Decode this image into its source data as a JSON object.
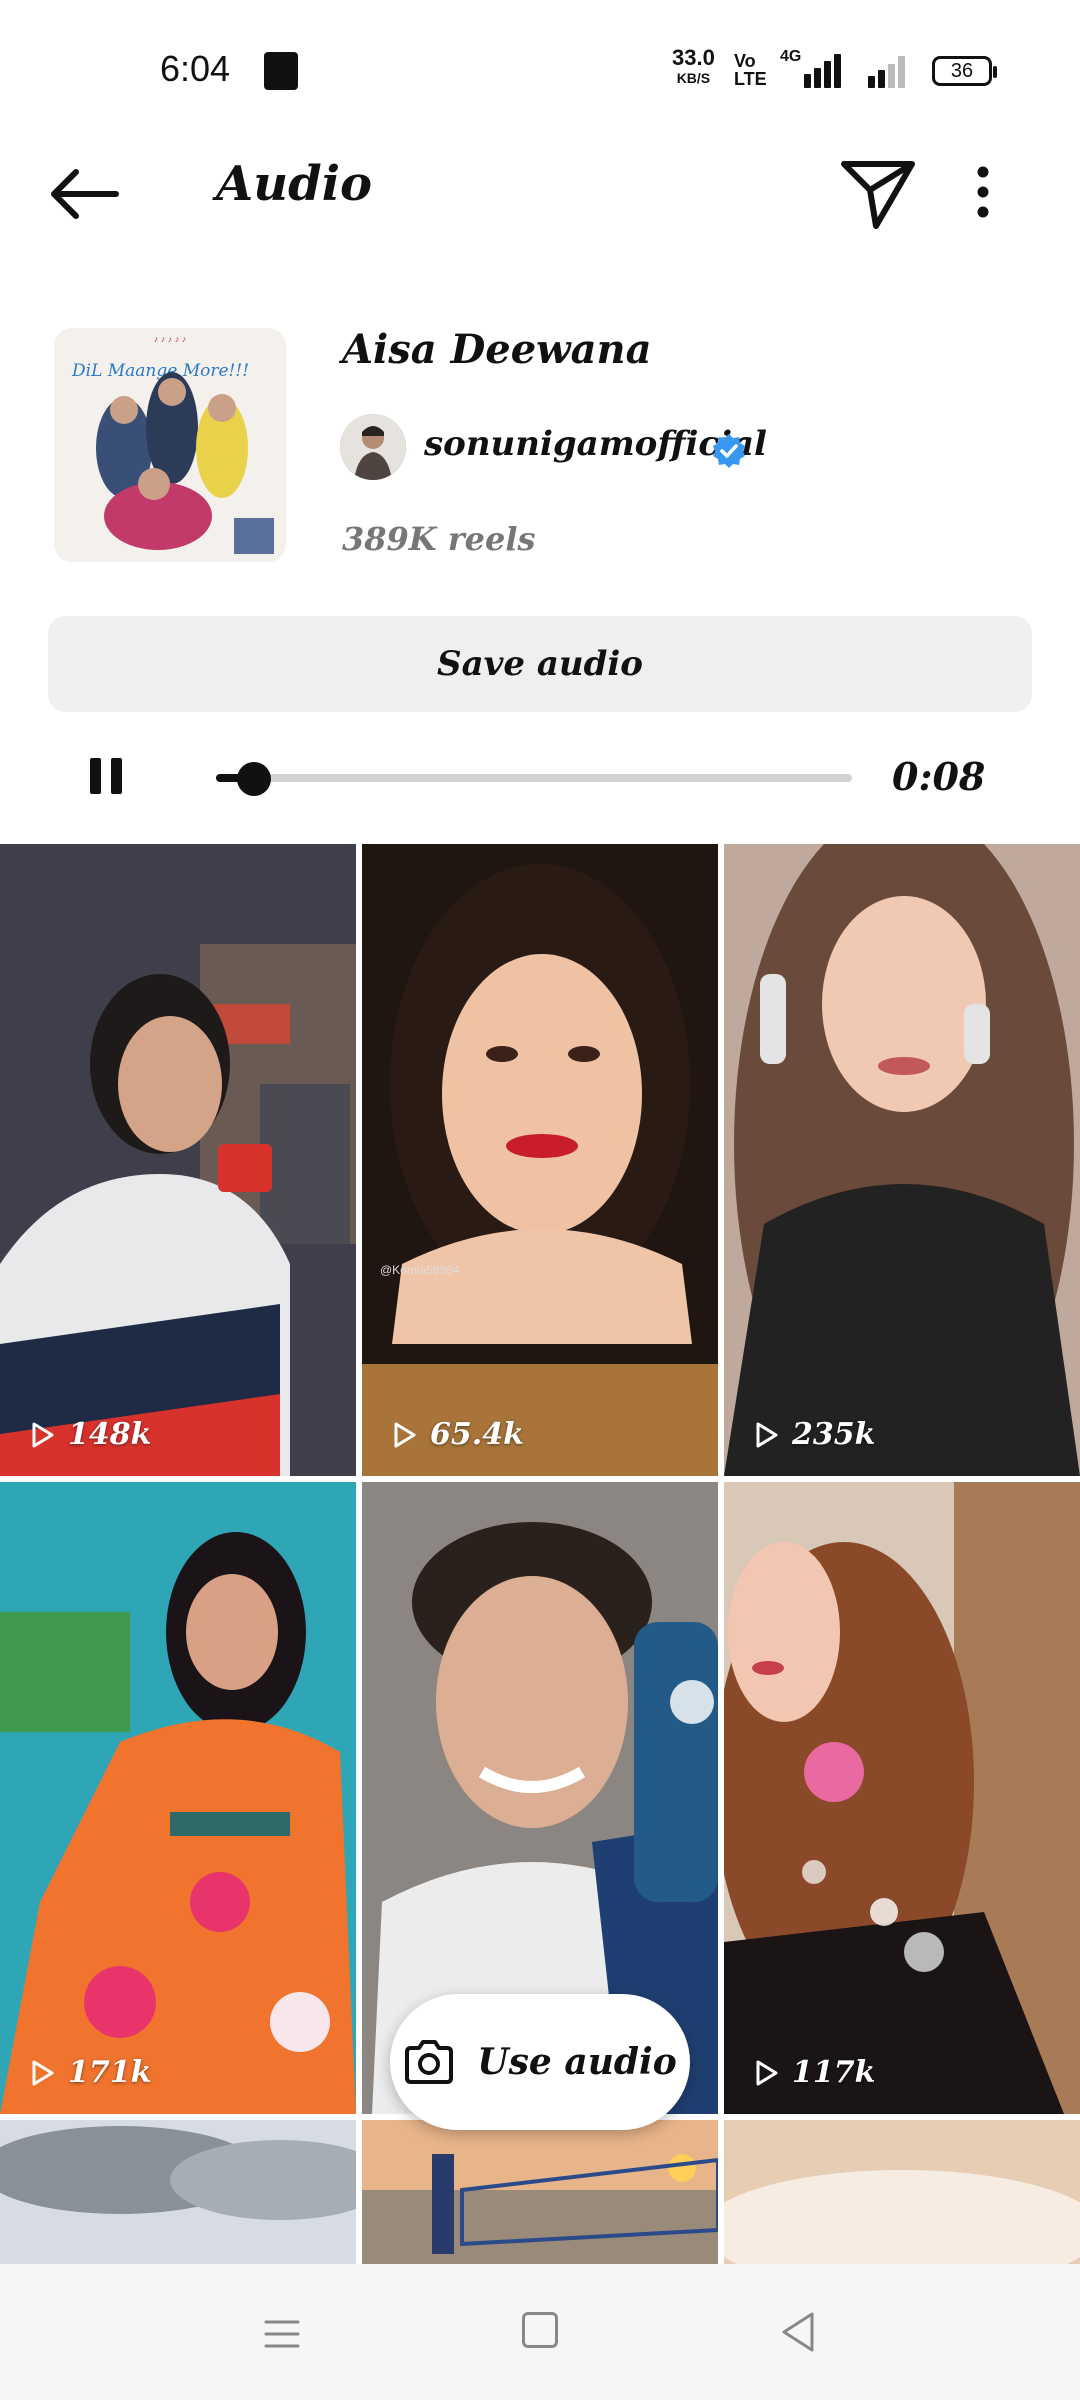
{
  "status": {
    "time": "6:04",
    "net_speed": "33.0",
    "net_unit": "KB/S",
    "volte": "Vo LTE",
    "network": "4G",
    "battery": "36"
  },
  "header": {
    "title": "Audio"
  },
  "audio": {
    "song_title": "Aisa Deewana",
    "artist": "sonunigamofficial",
    "reels_count": "389K reels",
    "save_label": "Save audio",
    "album_art_text": "DiL Maange More!!!"
  },
  "player": {
    "time": "0:08",
    "progress": 0.06
  },
  "grid": {
    "tiles": [
      {
        "views": "148k"
      },
      {
        "views": "65.4k"
      },
      {
        "views": "235k"
      },
      {
        "views": "171k"
      },
      {
        "views": ""
      },
      {
        "views": "117k"
      },
      {
        "views": ""
      },
      {
        "views": ""
      },
      {
        "views": ""
      }
    ],
    "watermark": "@Komla58984"
  },
  "fab": {
    "label": "Use audio"
  },
  "colors": {
    "verified": "#3897f0",
    "button_bg": "#efefef"
  }
}
